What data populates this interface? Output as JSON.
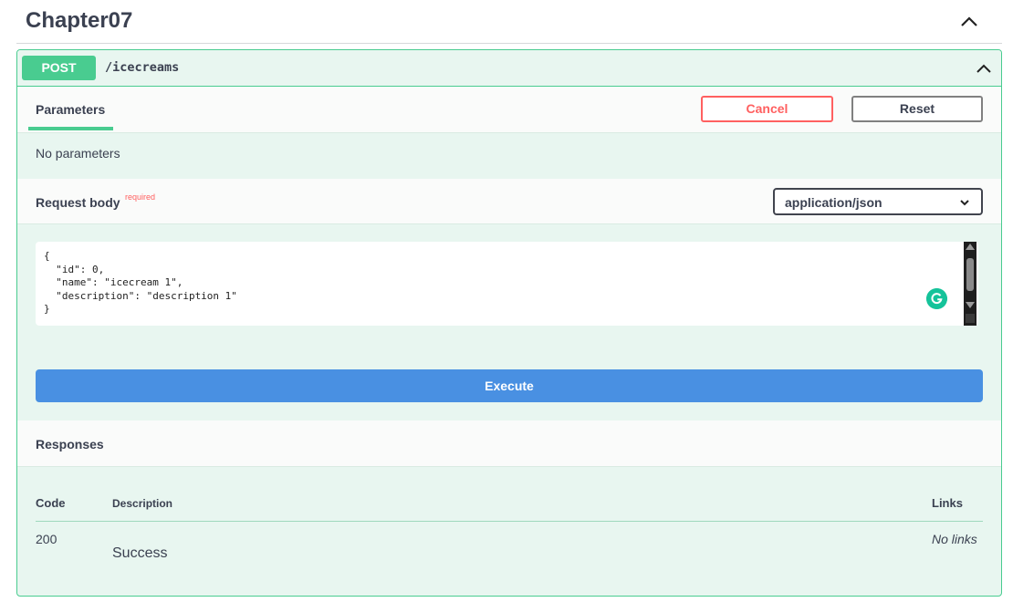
{
  "section": {
    "title": "Chapter07",
    "toggle_icon": "chevron-up-icon"
  },
  "operation": {
    "method": "POST",
    "path": "/icecreams",
    "method_color": "#49cc90",
    "toggle_icon": "chevron-up-icon"
  },
  "parameters": {
    "tab_label": "Parameters",
    "cancel_label": "Cancel",
    "reset_label": "Reset",
    "empty_text": "No parameters"
  },
  "request_body": {
    "title": "Request body",
    "required_label": "required",
    "content_type": "application/json",
    "body": "{\n  \"id\": 0,\n  \"name\": \"icecream 1\",\n  \"description\": \"description 1\"\n}"
  },
  "execute": {
    "label": "Execute",
    "color": "#4990e2"
  },
  "responses": {
    "title": "Responses",
    "columns": {
      "code": "Code",
      "description": "Description",
      "links": "Links"
    },
    "rows": [
      {
        "code": "200",
        "description": "Success",
        "links": "No links"
      }
    ]
  },
  "colors": {
    "post_green": "#49cc90",
    "cancel_red": "#ff6060",
    "text": "#3b4151"
  }
}
